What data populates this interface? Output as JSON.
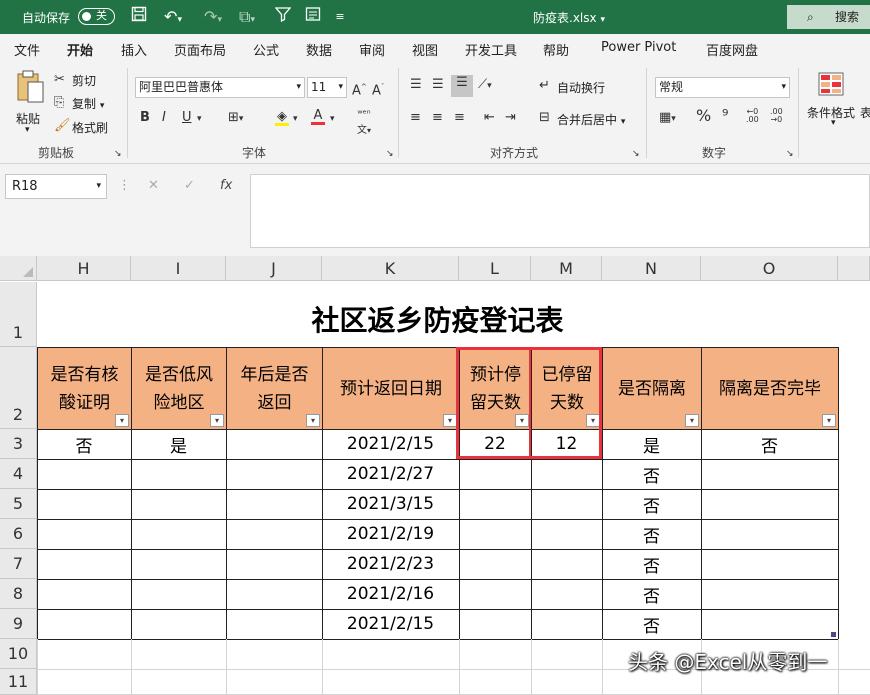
{
  "titlebar": {
    "autosave": "自动保存",
    "toggle": "关",
    "filename": "防疫表.xlsx",
    "filename_arrow": "▾",
    "search": "搜索"
  },
  "menu": [
    "文件",
    "开始",
    "插入",
    "页面布局",
    "公式",
    "数据",
    "审阅",
    "视图",
    "开发工具",
    "帮助",
    "Power Pivot",
    "百度网盘"
  ],
  "ribbon": {
    "paste": "粘贴",
    "cut": "剪切",
    "copy": "复制",
    "format_painter": "格式刷",
    "clipboard": "剪贴板",
    "font_name": "阿里巴巴普惠体",
    "font_size": "11",
    "font_group": "字体",
    "wrap": "自动换行",
    "merge": "合并后居中",
    "align_group": "对齐方式",
    "num_format": "常规",
    "number_group": "数字",
    "cond_format": "条件格式",
    "table_fmt": "表"
  },
  "formula_bar": {
    "name_box": "R18",
    "fx": "fx"
  },
  "sheet": {
    "columns": [
      "H",
      "I",
      "J",
      "K",
      "L",
      "M",
      "N",
      "O"
    ],
    "rows": [
      "1",
      "2",
      "3",
      "4",
      "5",
      "6",
      "7",
      "8",
      "9",
      "10",
      "11"
    ],
    "title": "社区返乡防疫登记表",
    "headers": [
      [
        "是否有核",
        "酸证明"
      ],
      [
        "是否低风",
        "险地区"
      ],
      [
        "年后是否",
        "返回"
      ],
      [
        "预计返回日期"
      ],
      [
        "预计停",
        "留天数"
      ],
      [
        "已停留",
        "天数"
      ],
      [
        "是否隔离"
      ],
      [
        "隔离是否完毕"
      ]
    ],
    "data": [
      [
        "否",
        "是",
        "",
        "2021/2/15",
        "22",
        "12",
        "是",
        "否"
      ],
      [
        "",
        "",
        "",
        "2021/2/27",
        "",
        "",
        "否",
        ""
      ],
      [
        "",
        "",
        "",
        "2021/3/15",
        "",
        "",
        "否",
        ""
      ],
      [
        "",
        "",
        "",
        "2021/2/19",
        "",
        "",
        "否",
        ""
      ],
      [
        "",
        "",
        "",
        "2021/2/23",
        "",
        "",
        "否",
        ""
      ],
      [
        "",
        "",
        "",
        "2021/2/16",
        "",
        "",
        "否",
        ""
      ],
      [
        "",
        "",
        "",
        "2021/2/15",
        "",
        "",
        "否",
        ""
      ]
    ],
    "highlight_color": "#e8323c",
    "header_fill": "#f4b183"
  },
  "watermark": "头条 @Excel从零到一"
}
